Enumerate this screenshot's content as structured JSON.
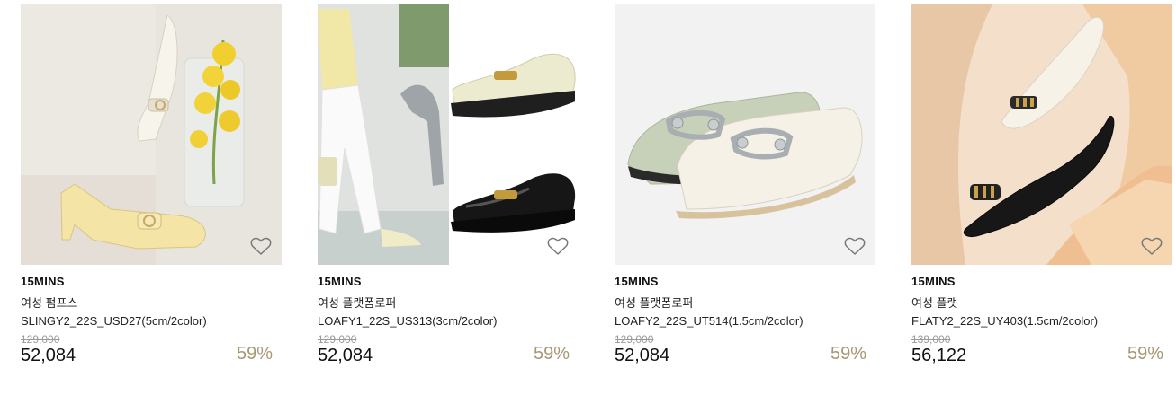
{
  "products": [
    {
      "brand": "15MINS",
      "name": "여성 펌프스",
      "model": "SLINGY2_22S_USD27(5cm/2color)",
      "original_price": "129,000",
      "sale_price": "52,084",
      "discount": "59%",
      "image_icon": "yellow-pumps-with-orchid-photo",
      "wishlist_icon": "heart-outline-icon"
    },
    {
      "brand": "15MINS",
      "name": "여성 플랫폼로퍼",
      "model": "LOAFY1_22S_US313(3cm/2color)",
      "original_price": "129,000",
      "sale_price": "52,084",
      "discount": "59%",
      "image_icon": "platform-loafers-photo",
      "wishlist_icon": "heart-outline-icon"
    },
    {
      "brand": "15MINS",
      "name": "여성 플랫폼로퍼",
      "model": "LOAFY2_22S_UT514(1.5cm/2color)",
      "original_price": "129,000",
      "sale_price": "52,084",
      "discount": "59%",
      "image_icon": "sage-and-cream-loafers-photo",
      "wishlist_icon": "heart-outline-icon"
    },
    {
      "brand": "15MINS",
      "name": "여성 플랫",
      "model": "FLATY2_22S_UY403(1.5cm/2color)",
      "original_price": "139,000",
      "sale_price": "56,122",
      "discount": "59%",
      "image_icon": "pointed-flats-photo",
      "wishlist_icon": "heart-outline-icon"
    }
  ],
  "colors": {
    "discount": "#a89774",
    "original_price": "#9a9a9a"
  }
}
